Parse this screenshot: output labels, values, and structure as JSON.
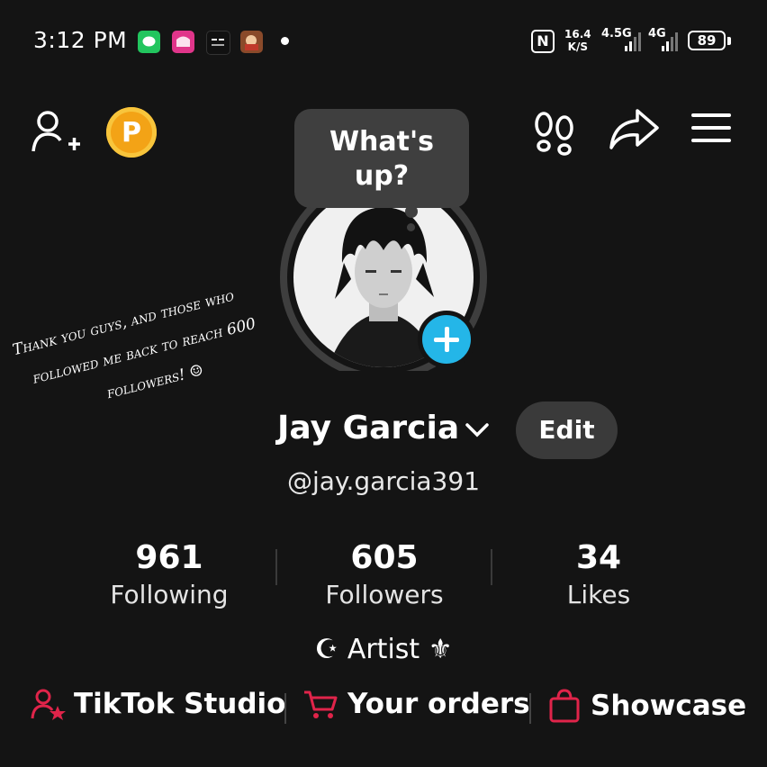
{
  "status_bar": {
    "time": "3:12 PM",
    "network_speed_value": "16.4",
    "network_speed_unit": "K/S",
    "network_1": "4.5G",
    "network_2": "4G",
    "battery": "89",
    "nfc_label": "N",
    "notification_icons": [
      "line-icon",
      "lazada-icon",
      "ai-app-icon",
      "game-icon"
    ]
  },
  "top_bar": {
    "coin_label": "P",
    "coin_color": "#f3a316"
  },
  "bubble": {
    "text_line1": "What's",
    "text_line2": "up?"
  },
  "note": {
    "line1": "Thank you guys, and those who",
    "line2": "followed me back to reach 600",
    "line3": "followers! ☺"
  },
  "profile": {
    "name": "Jay Garcia",
    "edit_label": "Edit",
    "handle": "@jay.garcia391",
    "bio": "☪ Artist ⚜"
  },
  "stats": [
    {
      "value": "961",
      "label": "Following"
    },
    {
      "value": "605",
      "label": "Followers"
    },
    {
      "value": "34",
      "label": "Likes"
    }
  ],
  "quick_links": [
    {
      "label": "TikTok Studio",
      "icon": "studio-icon"
    },
    {
      "label": "Your orders",
      "icon": "cart-icon"
    },
    {
      "label": "Showcase",
      "icon": "bag-icon"
    }
  ],
  "accent_colors": {
    "plus_badge": "#24b6e8",
    "quick_link_icon": "#e0244a"
  }
}
